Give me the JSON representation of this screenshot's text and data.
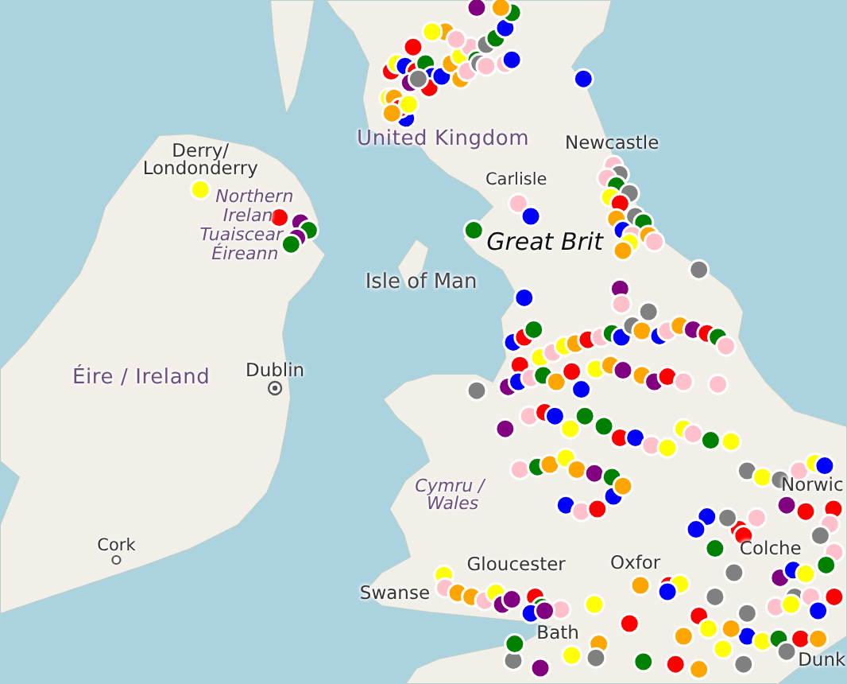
{
  "map": {
    "labels": [
      {
        "text": "United Kingdom",
        "kind": "country"
      },
      {
        "text": "Derry/",
        "kind": "city"
      },
      {
        "text": "Londonderry",
        "kind": "city"
      },
      {
        "text": "Northern",
        "kind": "region"
      },
      {
        "text": "Irelan",
        "kind": "region"
      },
      {
        "text": "Tuaiscear",
        "kind": "region"
      },
      {
        "text": "Éireann",
        "kind": "region"
      },
      {
        "text": "Isle of Man",
        "kind": "island"
      },
      {
        "text": "Newcastle",
        "kind": "city"
      },
      {
        "text": "Carlisle",
        "kind": "town"
      },
      {
        "text": "Great Brit",
        "kind": "mainland"
      },
      {
        "text": "Dublin",
        "kind": "city"
      },
      {
        "text": "Éire / Ireland",
        "kind": "country"
      },
      {
        "text": "Cork",
        "kind": "town"
      },
      {
        "text": "Swanse",
        "kind": "city"
      },
      {
        "text": "Cymru /",
        "kind": "region"
      },
      {
        "text": "Wales",
        "kind": "region"
      },
      {
        "text": "Gloucester",
        "kind": "city"
      },
      {
        "text": "Oxfor",
        "kind": "city"
      },
      {
        "text": "Bath",
        "kind": "city"
      },
      {
        "text": "Colche",
        "kind": "city"
      },
      {
        "text": "Norwic",
        "kind": "city"
      },
      {
        "text": "Dunk",
        "kind": "city"
      }
    ],
    "place_points": [
      {
        "kind": "capital"
      },
      {
        "kind": "town"
      }
    ],
    "markers": [
      {
        "color": "#ff0000"
      },
      {
        "color": "#ffff00"
      },
      {
        "color": "#0000ff"
      },
      {
        "color": "#ff0000"
      },
      {
        "color": "#008000"
      },
      {
        "color": "#0000ff"
      },
      {
        "color": "#800080"
      },
      {
        "color": "#ffff00"
      },
      {
        "color": "#ffff00"
      },
      {
        "color": "#ffa500"
      },
      {
        "color": "#0000ff"
      },
      {
        "color": "#ff0000"
      },
      {
        "color": "#ffa500"
      },
      {
        "color": "#ffff00"
      },
      {
        "color": "#ff0000"
      },
      {
        "color": "#0000ff"
      },
      {
        "color": "#ffa500"
      },
      {
        "color": "#ffff00"
      },
      {
        "color": "#ffc0cb"
      },
      {
        "color": "#008000"
      },
      {
        "color": "#808080"
      },
      {
        "color": "#008000"
      },
      {
        "color": "#0000ff"
      },
      {
        "color": "#008000"
      },
      {
        "color": "#ffa500"
      },
      {
        "color": "#800080"
      },
      {
        "color": "#ffa500"
      },
      {
        "color": "#ffc0cb"
      },
      {
        "color": "#ffa500"
      },
      {
        "color": "#ffc0cb"
      },
      {
        "color": "#808080"
      },
      {
        "color": "#ffc0cb"
      },
      {
        "color": "#ffc0cb"
      },
      {
        "color": "#0000ff"
      },
      {
        "color": "#808080"
      },
      {
        "color": "#ffff00"
      },
      {
        "color": "#ff0000"
      },
      {
        "color": "#0000ff"
      },
      {
        "color": "#ffc0cb"
      },
      {
        "color": "#808080"
      },
      {
        "color": "#ffc0cb"
      },
      {
        "color": "#008000"
      },
      {
        "color": "#808080"
      },
      {
        "color": "#ffff00"
      },
      {
        "color": "#ff0000"
      },
      {
        "color": "#ffa500"
      },
      {
        "color": "#808080"
      },
      {
        "color": "#008000"
      },
      {
        "color": "#0000ff"
      },
      {
        "color": "#ffc0cb"
      },
      {
        "color": "#ffff00"
      },
      {
        "color": "#ffa500"
      },
      {
        "color": "#ffc0cb"
      },
      {
        "color": "#ffa500"
      },
      {
        "color": "#808080"
      },
      {
        "color": "#ffc0cb"
      },
      {
        "color": "#0000ff"
      },
      {
        "color": "#008000"
      },
      {
        "color": "#0000ff"
      },
      {
        "color": "#800080"
      },
      {
        "color": "#ffc0cb"
      },
      {
        "color": "#808080"
      },
      {
        "color": "#0000ff"
      },
      {
        "color": "#ff0000"
      },
      {
        "color": "#008000"
      },
      {
        "color": "#ff0000"
      },
      {
        "color": "#ffff00"
      },
      {
        "color": "#ffc0cb"
      },
      {
        "color": "#ffff00"
      },
      {
        "color": "#ffa500"
      },
      {
        "color": "#ff0000"
      },
      {
        "color": "#ffc0cb"
      },
      {
        "color": "#008000"
      },
      {
        "color": "#0000ff"
      },
      {
        "color": "#808080"
      },
      {
        "color": "#ffa500"
      },
      {
        "color": "#0000ff"
      },
      {
        "color": "#ffc0cb"
      },
      {
        "color": "#ffa500"
      },
      {
        "color": "#800080"
      },
      {
        "color": "#ff0000"
      },
      {
        "color": "#008000"
      },
      {
        "color": "#ffc0cb"
      },
      {
        "color": "#808080"
      },
      {
        "color": "#800080"
      },
      {
        "color": "#0000ff"
      },
      {
        "color": "#ffc0cb"
      },
      {
        "color": "#008000"
      },
      {
        "color": "#ffa500"
      },
      {
        "color": "#ff0000"
      },
      {
        "color": "#0000ff"
      },
      {
        "color": "#ffff00"
      },
      {
        "color": "#ffa500"
      },
      {
        "color": "#800080"
      },
      {
        "color": "#ffa500"
      },
      {
        "color": "#800080"
      },
      {
        "color": "#ff0000"
      },
      {
        "color": "#ffc0cb"
      },
      {
        "color": "#ffc0cb"
      },
      {
        "color": "#800080"
      },
      {
        "color": "#ffc0cb"
      },
      {
        "color": "#ff0000"
      },
      {
        "color": "#0000ff"
      },
      {
        "color": "#ffff00"
      },
      {
        "color": "#008000"
      },
      {
        "color": "#008000"
      },
      {
        "color": "#ff0000"
      },
      {
        "color": "#0000ff"
      },
      {
        "color": "#ffc0cb"
      },
      {
        "color": "#ffff00"
      },
      {
        "color": "#ffff00"
      },
      {
        "color": "#ffc0cb"
      },
      {
        "color": "#008000"
      },
      {
        "color": "#ffc0cb"
      },
      {
        "color": "#008000"
      },
      {
        "color": "#ffa500"
      },
      {
        "color": "#ffff00"
      },
      {
        "color": "#ffa500"
      },
      {
        "color": "#800080"
      },
      {
        "color": "#008000"
      },
      {
        "color": "#0000ff"
      },
      {
        "color": "#ffc0cb"
      },
      {
        "color": "#ff0000"
      },
      {
        "color": "#0000ff"
      },
      {
        "color": "#ffa500"
      },
      {
        "color": "#ffff00"
      },
      {
        "color": "#808080"
      },
      {
        "color": "#ffff00"
      },
      {
        "color": "#808080"
      },
      {
        "color": "#ffc0cb"
      },
      {
        "color": "#ffff00"
      },
      {
        "color": "#0000ff"
      },
      {
        "color": "#ff0000"
      },
      {
        "color": "#ffc0cb"
      },
      {
        "color": "#ff0000"
      },
      {
        "color": "#800080"
      },
      {
        "color": "#ffc0cb"
      },
      {
        "color": "#ff0000"
      },
      {
        "color": "#808080"
      },
      {
        "color": "#0000ff"
      },
      {
        "color": "#0000ff"
      },
      {
        "color": "#008000"
      },
      {
        "color": "#ff0000"
      },
      {
        "color": "#808080"
      },
      {
        "color": "#800080"
      },
      {
        "color": "#808080"
      },
      {
        "color": "#ffc0cb"
      },
      {
        "color": "#008000"
      },
      {
        "color": "#0000ff"
      },
      {
        "color": "#ffff00"
      },
      {
        "color": "#808080"
      },
      {
        "color": "#ffc0cb"
      },
      {
        "color": "#ff0000"
      },
      {
        "color": "#ff0000"
      },
      {
        "color": "#ffc0cb"
      },
      {
        "color": "#ffff00"
      },
      {
        "color": "#ff0000"
      },
      {
        "color": "#ffa500"
      },
      {
        "color": "#ff0000"
      },
      {
        "color": "#ffff00"
      },
      {
        "color": "#ff0000"
      },
      {
        "color": "#808080"
      },
      {
        "color": "#ffc0cb"
      },
      {
        "color": "#ffff00"
      },
      {
        "color": "#0000ff"
      },
      {
        "color": "#0000ff"
      },
      {
        "color": "#ffff00"
      },
      {
        "color": "#008000"
      },
      {
        "color": "#ff0000"
      },
      {
        "color": "#ffa500"
      },
      {
        "color": "#ffff00"
      },
      {
        "color": "#ffff00"
      },
      {
        "color": "#ffa500"
      },
      {
        "color": "#0000ff"
      },
      {
        "color": "#808080"
      },
      {
        "color": "#ffa500"
      },
      {
        "color": "#008000"
      },
      {
        "color": "#ff0000"
      },
      {
        "color": "#ffa500"
      },
      {
        "color": "#808080"
      },
      {
        "color": "#808080"
      },
      {
        "color": "#ffa500"
      },
      {
        "color": "#808080"
      },
      {
        "color": "#008000"
      },
      {
        "color": "#800080"
      },
      {
        "color": "#ffff00"
      },
      {
        "color": "#808080"
      },
      {
        "color": "#ffff00"
      },
      {
        "color": "#ffc0cb"
      },
      {
        "color": "#ffa500"
      },
      {
        "color": "#ffa500"
      },
      {
        "color": "#ffc0cb"
      },
      {
        "color": "#ffff00"
      },
      {
        "color": "#800080"
      },
      {
        "color": "#800080"
      },
      {
        "color": "#008000"
      },
      {
        "color": "#0000ff"
      },
      {
        "color": "#800080"
      },
      {
        "color": "#ffff00"
      },
      {
        "color": "#ff0000"
      },
      {
        "color": "#800080"
      },
      {
        "color": "#008000"
      },
      {
        "color": "#800080"
      },
      {
        "color": "#008000"
      }
    ]
  }
}
